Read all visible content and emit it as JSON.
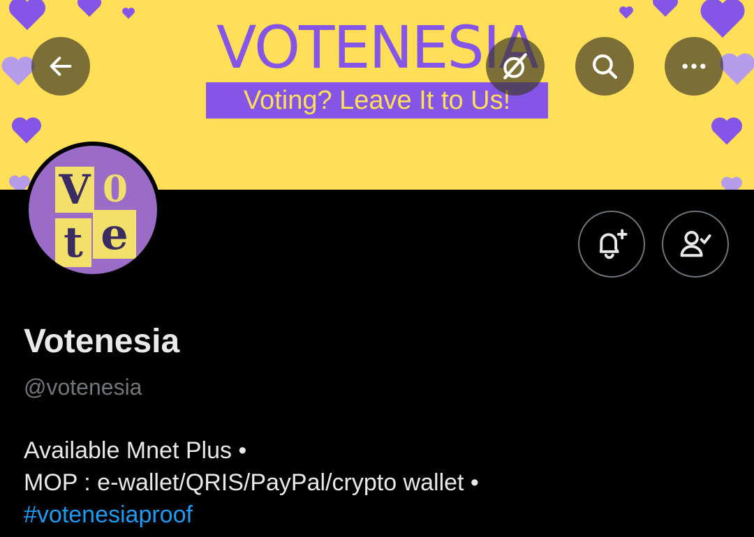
{
  "banner": {
    "title": "VOTENESIA",
    "tagline": "Voting? Leave It to Us!",
    "colors": {
      "background": "#FFDF57",
      "accent": "#8555E8",
      "heart": "#8555E8",
      "heart_faded": "#B79BEB"
    }
  },
  "header_buttons": {
    "back_icon": "arrow-left-icon",
    "grok_icon": "grok-slash-icon",
    "search_icon": "search-icon",
    "more_icon": "more-horizontal-icon"
  },
  "avatar": {
    "letters": [
      "V",
      "0",
      "t",
      "e"
    ]
  },
  "actions": {
    "notify_icon": "bell-plus-icon",
    "following_icon": "person-check-icon"
  },
  "profile": {
    "display_name": "Votenesia",
    "handle": "@votenesia",
    "bio_line1": "Available Mnet Plus •",
    "bio_line2": "MOP : e-wallet/QRIS/PayPal/crypto wallet •",
    "hashtag": "#votenesiaproof"
  },
  "colors": {
    "page_background": "#000000",
    "text_primary": "#E7E9EA",
    "text_secondary": "#71767B",
    "link": "#1D9BF0"
  }
}
